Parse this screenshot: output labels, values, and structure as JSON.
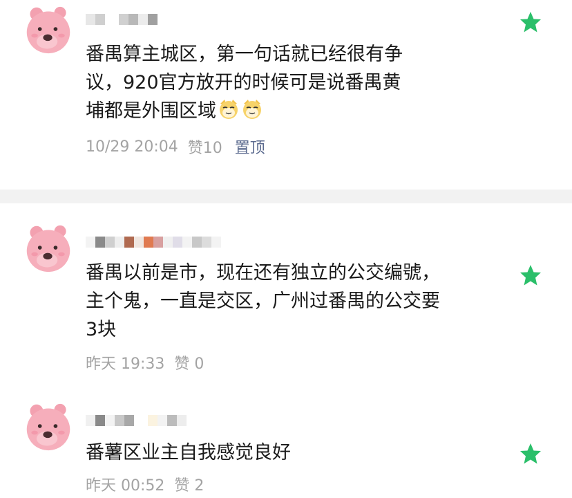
{
  "comments": [
    {
      "text": "番禺算主城区，第一句话就已经很有争议，920官方放开的时候可是说番禺黄埔都是外围区域",
      "lines": [
        "番禺算主城区，第一句话就已经很有争",
        "议，920官方放开的时候可是说番禺黄",
        "埔都是外围区域"
      ],
      "time": "10/29 20:04",
      "likes": "赞10",
      "pinned": "置顶",
      "avatar_icon": "pink-bear-avatar",
      "star_icon": "green-star-icon",
      "emoji_icon": "cat-emoji-icon"
    },
    {
      "text": "番禺以前是市，现在还有独立的公交编號，主个鬼，一直是交区，广州过番禺的公交要3块",
      "lines": [
        "番禺以前是市，现在还有独立的公交编號，",
        "主个鬼，一直是交区，广州过番禺的公交要",
        "3块"
      ],
      "time": "昨天 19:33",
      "likes": "赞 0",
      "avatar_icon": "pink-bear-avatar",
      "star_icon": "green-star-icon"
    },
    {
      "text": "番薯区业主自我感觉良好",
      "lines": [
        "番薯区业主自我感觉良好"
      ],
      "time": "昨天 00:52",
      "likes": "赞 2",
      "avatar_icon": "pink-bear-avatar",
      "star_icon": "green-star-icon"
    }
  ],
  "colors": {
    "star": "#2bbf6a",
    "pinned": "#5c6b8f",
    "meta": "#a3a3a3",
    "separator": "#f2f2f2",
    "avatar": "#f5a6b3"
  }
}
